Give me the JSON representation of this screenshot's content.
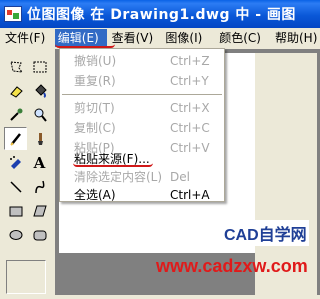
{
  "window": {
    "title": "位图图像 在 Drawing1.dwg 中 - 画图"
  },
  "menubar": {
    "file": "文件(F)",
    "edit": "编辑(E)",
    "view": "查看(V)",
    "image": "图像(I)",
    "color": "颜色(C)",
    "help": "帮助(H)"
  },
  "edit_menu": {
    "items": [
      {
        "label": "撤销(U)",
        "shortcut": "Ctrl+Z",
        "enabled": false
      },
      {
        "label": "重复(R)",
        "shortcut": "Ctrl+Y",
        "enabled": false
      },
      {
        "label": "剪切(T)",
        "shortcut": "Ctrl+X",
        "enabled": false
      },
      {
        "label": "复制(C)",
        "shortcut": "Ctrl+C",
        "enabled": false
      },
      {
        "label": "粘贴(P)",
        "shortcut": "Ctrl+V",
        "enabled": false
      },
      {
        "label": "粘贴来源(F)...",
        "shortcut": "",
        "enabled": true
      },
      {
        "label": "清除选定内容(L)",
        "shortcut": "Del",
        "enabled": false
      },
      {
        "label": "全选(A)",
        "shortcut": "Ctrl+A",
        "enabled": true
      }
    ]
  },
  "tools": [
    "free-select",
    "rect-select",
    "eraser",
    "fill",
    "color-picker",
    "magnifier",
    "pencil",
    "brush",
    "airbrush",
    "text",
    "line",
    "curve",
    "rectangle",
    "polygon",
    "ellipse",
    "rounded-rectangle"
  ],
  "watermark": {
    "logo": "CAD自学网",
    "url": "www.cadzxw.com"
  },
  "colors": {
    "title_bar": "#0a58d8",
    "menu_highlight": "#316ac5",
    "annotation_red": "#d01818",
    "watermark_blue": "#1f3f96"
  }
}
